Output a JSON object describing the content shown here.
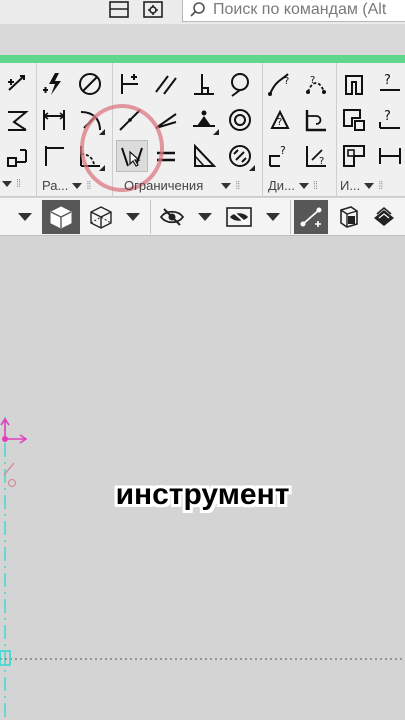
{
  "search": {
    "placeholder": "Поиск по командам (Alt"
  },
  "ribbon": {
    "groups": [
      {
        "label": "Ра..."
      },
      {
        "label": "Ограничения"
      },
      {
        "label": "Ди..."
      },
      {
        "label": "И..."
      }
    ]
  },
  "caption": {
    "text": "инструмент"
  },
  "colors": {
    "accent_green": "#5fd68c",
    "highlight": "#dc7882",
    "axis_magenta": "#e040c0",
    "axis_cyan": "#3ad7d0"
  }
}
